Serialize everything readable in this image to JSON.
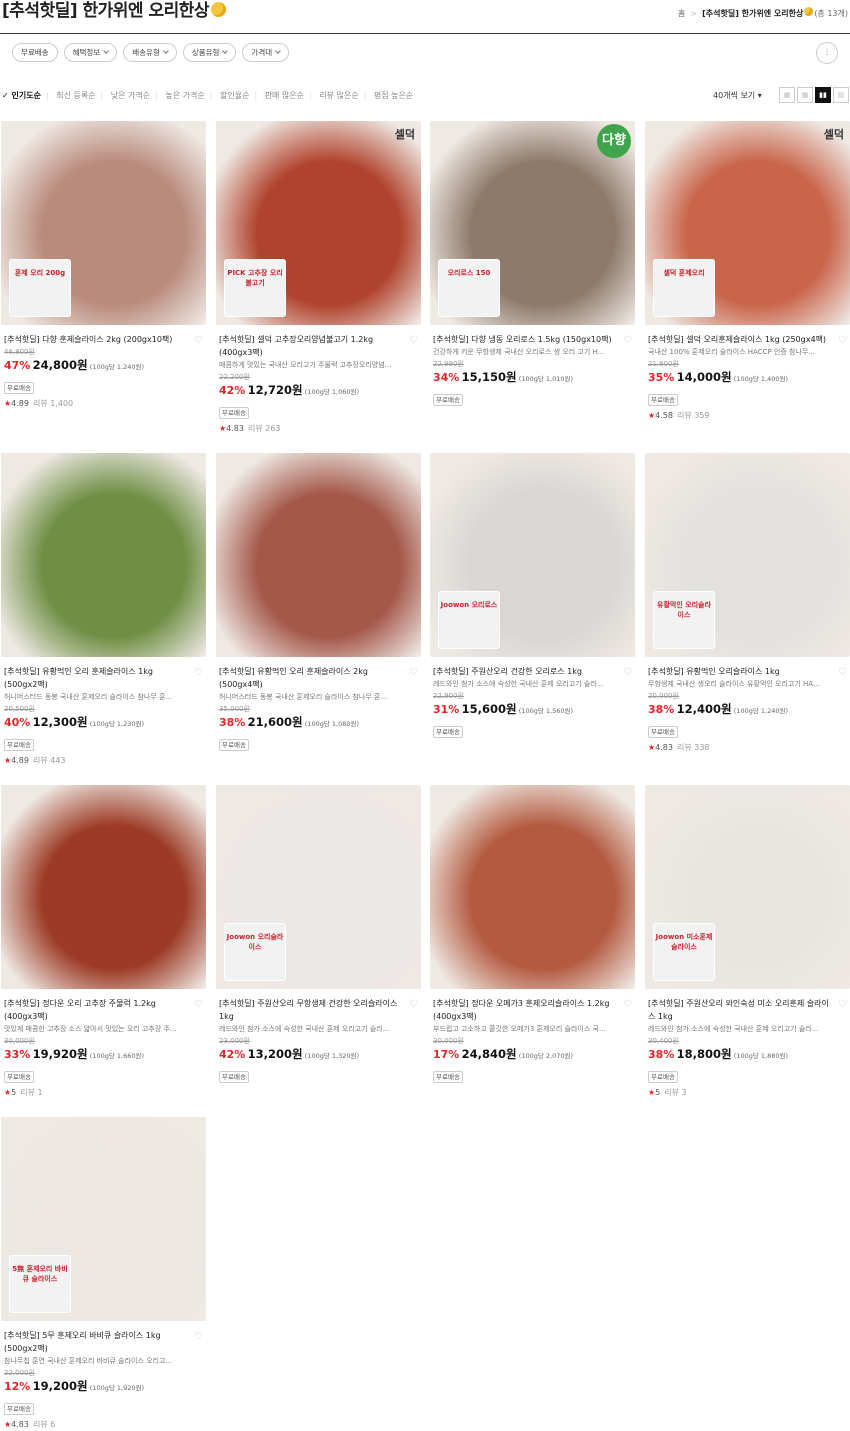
{
  "header": {
    "title": "[추석핫딜] 한가위엔 오리한상"
  },
  "breadcrumb": {
    "home": "홈",
    "current": "[추석핫딜] 한가위엔 오리한상",
    "count": "(총 13개)"
  },
  "filters": [
    "무료배송",
    "혜택정보",
    "배송유형",
    "상품유형",
    "가격대"
  ],
  "sorts": [
    "인기도순",
    "최신 등록순",
    "낮은 가격순",
    "높은 가격순",
    "할인율순",
    "판매 많은순",
    "리뷰 많은순",
    "평점 높은순"
  ],
  "per_page": "40개씩 보기",
  "products": [
    {
      "name": "[추석핫딜] 다향 훈제슬라이스 2kg (200gx10팩)",
      "desc": "",
      "orig": "46,800원",
      "disc": "47%",
      "price": "24,800원",
      "unit": "(100g당 1,240원)",
      "ship": "무료배송",
      "rating": "4.89",
      "reviews": "리뷰 1,400",
      "badge": "",
      "img": "#b98b7c",
      "pack": "훈제 오리 200g"
    },
    {
      "name": "[추석핫딜] 셀덕 고추장오리양념불고기 1.2kg (400gx3팩)",
      "desc": "매콤하게 맛있는 국내산 오리고기 주물럭 고추장오리양념...",
      "orig": "22,200원",
      "disc": "42%",
      "price": "12,720원",
      "unit": "(100g당 1,060원)",
      "ship": "무료배송",
      "rating": "4.83",
      "reviews": "리뷰 263",
      "badge": "셀덕",
      "img": "#b0432d",
      "pack": "PICK 고추장 오리불고기"
    },
    {
      "name": "[추석핫딜] 다향 냉동 오리로스 1.5kg (150gx10팩)",
      "desc": "건강하게 키운 무항생제 국내산 오리로스 생 오리 고기 H...",
      "orig": "22,990원",
      "disc": "34%",
      "price": "15,150원",
      "unit": "(100g당 1,010원)",
      "ship": "무료배송",
      "rating": "",
      "reviews": "",
      "badge": "다향",
      "img": "#8e7a6a",
      "pack": "오리로스 150"
    },
    {
      "name": "[추석핫딜] 셀덕 오리훈제슬라이스 1kg (250gx4팩)",
      "desc": "국내산 100% 훈제오리 슬라이스 HACCP 인증 참나무...",
      "orig": "21,600원",
      "disc": "35%",
      "price": "14,000원",
      "unit": "(100g당 1,400원)",
      "ship": "무료배송",
      "rating": "4.58",
      "reviews": "리뷰 359",
      "badge": "셀덕",
      "img": "#c9654b",
      "pack": "셀덕 훈제오리"
    },
    {
      "name": "[추석핫딜] 유황먹인 오리 훈제슬라이스 1kg (500gx2팩)",
      "desc": "허니머스터드 동봉 국내산 훈제오리 슬라이스 참나무 훈...",
      "orig": "20,500원",
      "disc": "40%",
      "price": "12,300원",
      "unit": "(100g당 1,230원)",
      "ship": "무료배송",
      "rating": "4.89",
      "reviews": "리뷰 443",
      "badge": "",
      "img": "#6f8f45",
      "pack": ""
    },
    {
      "name": "[추석핫딜] 유황먹인 오리 훈제슬라이스 2kg (500gx4팩)",
      "desc": "허니머스터드 동봉 국내산 훈제오리 슬라이스 참나무 훈...",
      "orig": "35,000원",
      "disc": "38%",
      "price": "21,600원",
      "unit": "(100g당 1,080원)",
      "ship": "무료배송",
      "rating": "",
      "reviews": "",
      "badge": "",
      "img": "#a4584a",
      "pack": ""
    },
    {
      "name": "[추석핫딜] 주원산오리 건강한 오리로스 1kg",
      "desc": "레드와인 첨가 소스에 숙성한 국내산 훈제 오리고기 슬라...",
      "orig": "22,900원",
      "disc": "31%",
      "price": "15,600원",
      "unit": "(100g당 1,560원)",
      "ship": "무료배송",
      "rating": "",
      "reviews": "",
      "badge": "",
      "img": "#d9d6d3",
      "pack": "Joowon 오리로스"
    },
    {
      "name": "[추석핫딜] 유황먹인 오리슬라이스 1kg",
      "desc": "무항생제 국내산 생오리 슬라이스 유황먹인 오리고기 HA...",
      "orig": "20,000원",
      "disc": "38%",
      "price": "12,400원",
      "unit": "(100g당 1,240원)",
      "ship": "무료배송",
      "rating": "4.83",
      "reviews": "리뷰 338",
      "badge": "",
      "img": "#e3e1de",
      "pack": "유황먹인 오리슬라이스"
    },
    {
      "name": "[추석핫딜] 정다운 오리 고추장 주물럭 1.2kg (400gx3팩)",
      "desc": "맛있게 매콤한 고추장 소스 얇아서 맛있는 오리 고추장 주...",
      "orig": "30,000원",
      "disc": "33%",
      "price": "19,920원",
      "unit": "(100g당 1,660원)",
      "ship": "무료배송",
      "rating": "5",
      "reviews": "리뷰 1",
      "badge": "",
      "img": "#9c3b25",
      "pack": ""
    },
    {
      "name": "[추석핫딜] 주원산오리 무항생제 건강한 오리슬라이스 1kg",
      "desc": "레드와인 첨가 소스에 숙성한 국내산 훈제 오리고기 슬라...",
      "orig": "23,000원",
      "disc": "42%",
      "price": "13,200원",
      "unit": "(100g당 1,320원)",
      "ship": "무료배송",
      "rating": "",
      "reviews": "",
      "badge": "",
      "img": "#ebe8e6",
      "pack": "Joowon 오리슬라이스"
    },
    {
      "name": "[추석핫딜] 정다운 오메가3 훈제오리슬라이스 1.2kg (400gx3팩)",
      "desc": "부드럽고 고소하고 쫄깃한 오메가3 훈제오리 슬라이스 국...",
      "orig": "30,000원",
      "disc": "17%",
      "price": "24,840원",
      "unit": "(100g당 2,070원)",
      "ship": "무료배송",
      "rating": "",
      "reviews": "",
      "badge": "",
      "img": "#b35a3f",
      "pack": ""
    },
    {
      "name": "[추석핫딜] 주원산오리 와인숙성 미소 오리훈제 슬라이스 1kg",
      "desc": "레드와인 첨가 소스에 숙성한 국내산 훈제 오리고기 슬라...",
      "orig": "30,400원",
      "disc": "38%",
      "price": "18,800원",
      "unit": "(100g당 1,880원)",
      "ship": "무료배송",
      "rating": "5",
      "reviews": "리뷰 3",
      "badge": "",
      "img": "#e9e6e2",
      "pack": "Joowon 미소훈제슬라이스"
    },
    {
      "name": "[추석핫딜] 5무 훈제오리 바비큐 슬라이스 1kg (500gx2팩)",
      "desc": "참나무칩 훈연 국내산 훈제오리 바비큐 슬라이스 오리고...",
      "orig": "22,000원",
      "disc": "12%",
      "price": "19,200원",
      "unit": "(100g당 1,920원)",
      "ship": "무료배송",
      "rating": "4.83",
      "reviews": "리뷰 6",
      "badge": "",
      "img": "#ece7e2",
      "pack": "5無 훈제오리 바비큐 슬라이스"
    }
  ]
}
